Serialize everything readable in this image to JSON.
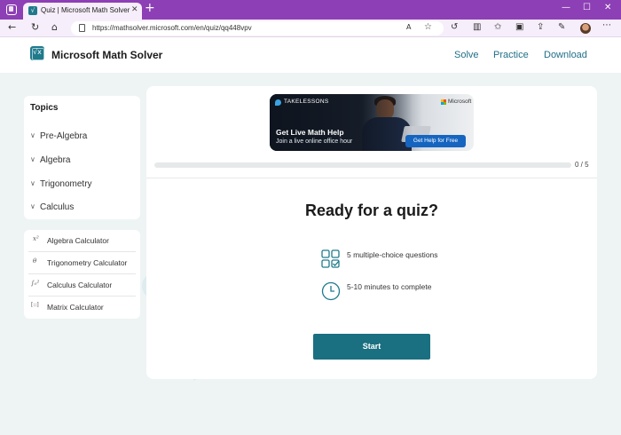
{
  "browser": {
    "tab_title": "Quiz | Microsoft Math Solver",
    "tab_close": "✕",
    "new_tab": "+",
    "url": "https://mathsolver.microsoft.com/en/quiz/qq448vpv",
    "window_controls": {
      "minimize": "—",
      "maximize": "☐",
      "close": "✕"
    }
  },
  "header": {
    "brand": "Microsoft Math Solver",
    "logo_glyph": "√x",
    "nav": [
      {
        "label": "Solve"
      },
      {
        "label": "Practice"
      },
      {
        "label": "Download"
      }
    ]
  },
  "sidebar": {
    "topics_title": "Topics",
    "topics": [
      {
        "label": "Pre-Algebra"
      },
      {
        "label": "Algebra"
      },
      {
        "label": "Trigonometry"
      },
      {
        "label": "Calculus"
      }
    ],
    "calculators": [
      {
        "label": "Algebra Calculator",
        "glyph": "x²"
      },
      {
        "label": "Trigonometry Calculator",
        "glyph": "θ"
      },
      {
        "label": "Calculus Calculator",
        "glyph": "∫₀²"
      },
      {
        "label": "Matrix Calculator",
        "glyph": "[::]"
      }
    ]
  },
  "banner": {
    "brand": "TAKELESSONS",
    "partner": "Microsoft",
    "title": "Get Live Math Help",
    "subtitle": "Join a live online office hour",
    "cta": "Get Help for Free"
  },
  "quiz": {
    "progress": {
      "current": 0,
      "total": 5,
      "label": "0 / 5"
    },
    "title": "Ready for a quiz?",
    "info": [
      {
        "text": "5 multiple-choice questions",
        "icon": "grid-check-icon"
      },
      {
        "text": "5-10 minutes to complete",
        "icon": "clock-icon"
      }
    ],
    "start_label": "Start"
  },
  "colors": {
    "accent": "#1f7a8c",
    "link": "#1f6f86",
    "browser_frame": "#8d3fb5",
    "page_bg": "#eef4f4",
    "decor": "#ddecef"
  }
}
